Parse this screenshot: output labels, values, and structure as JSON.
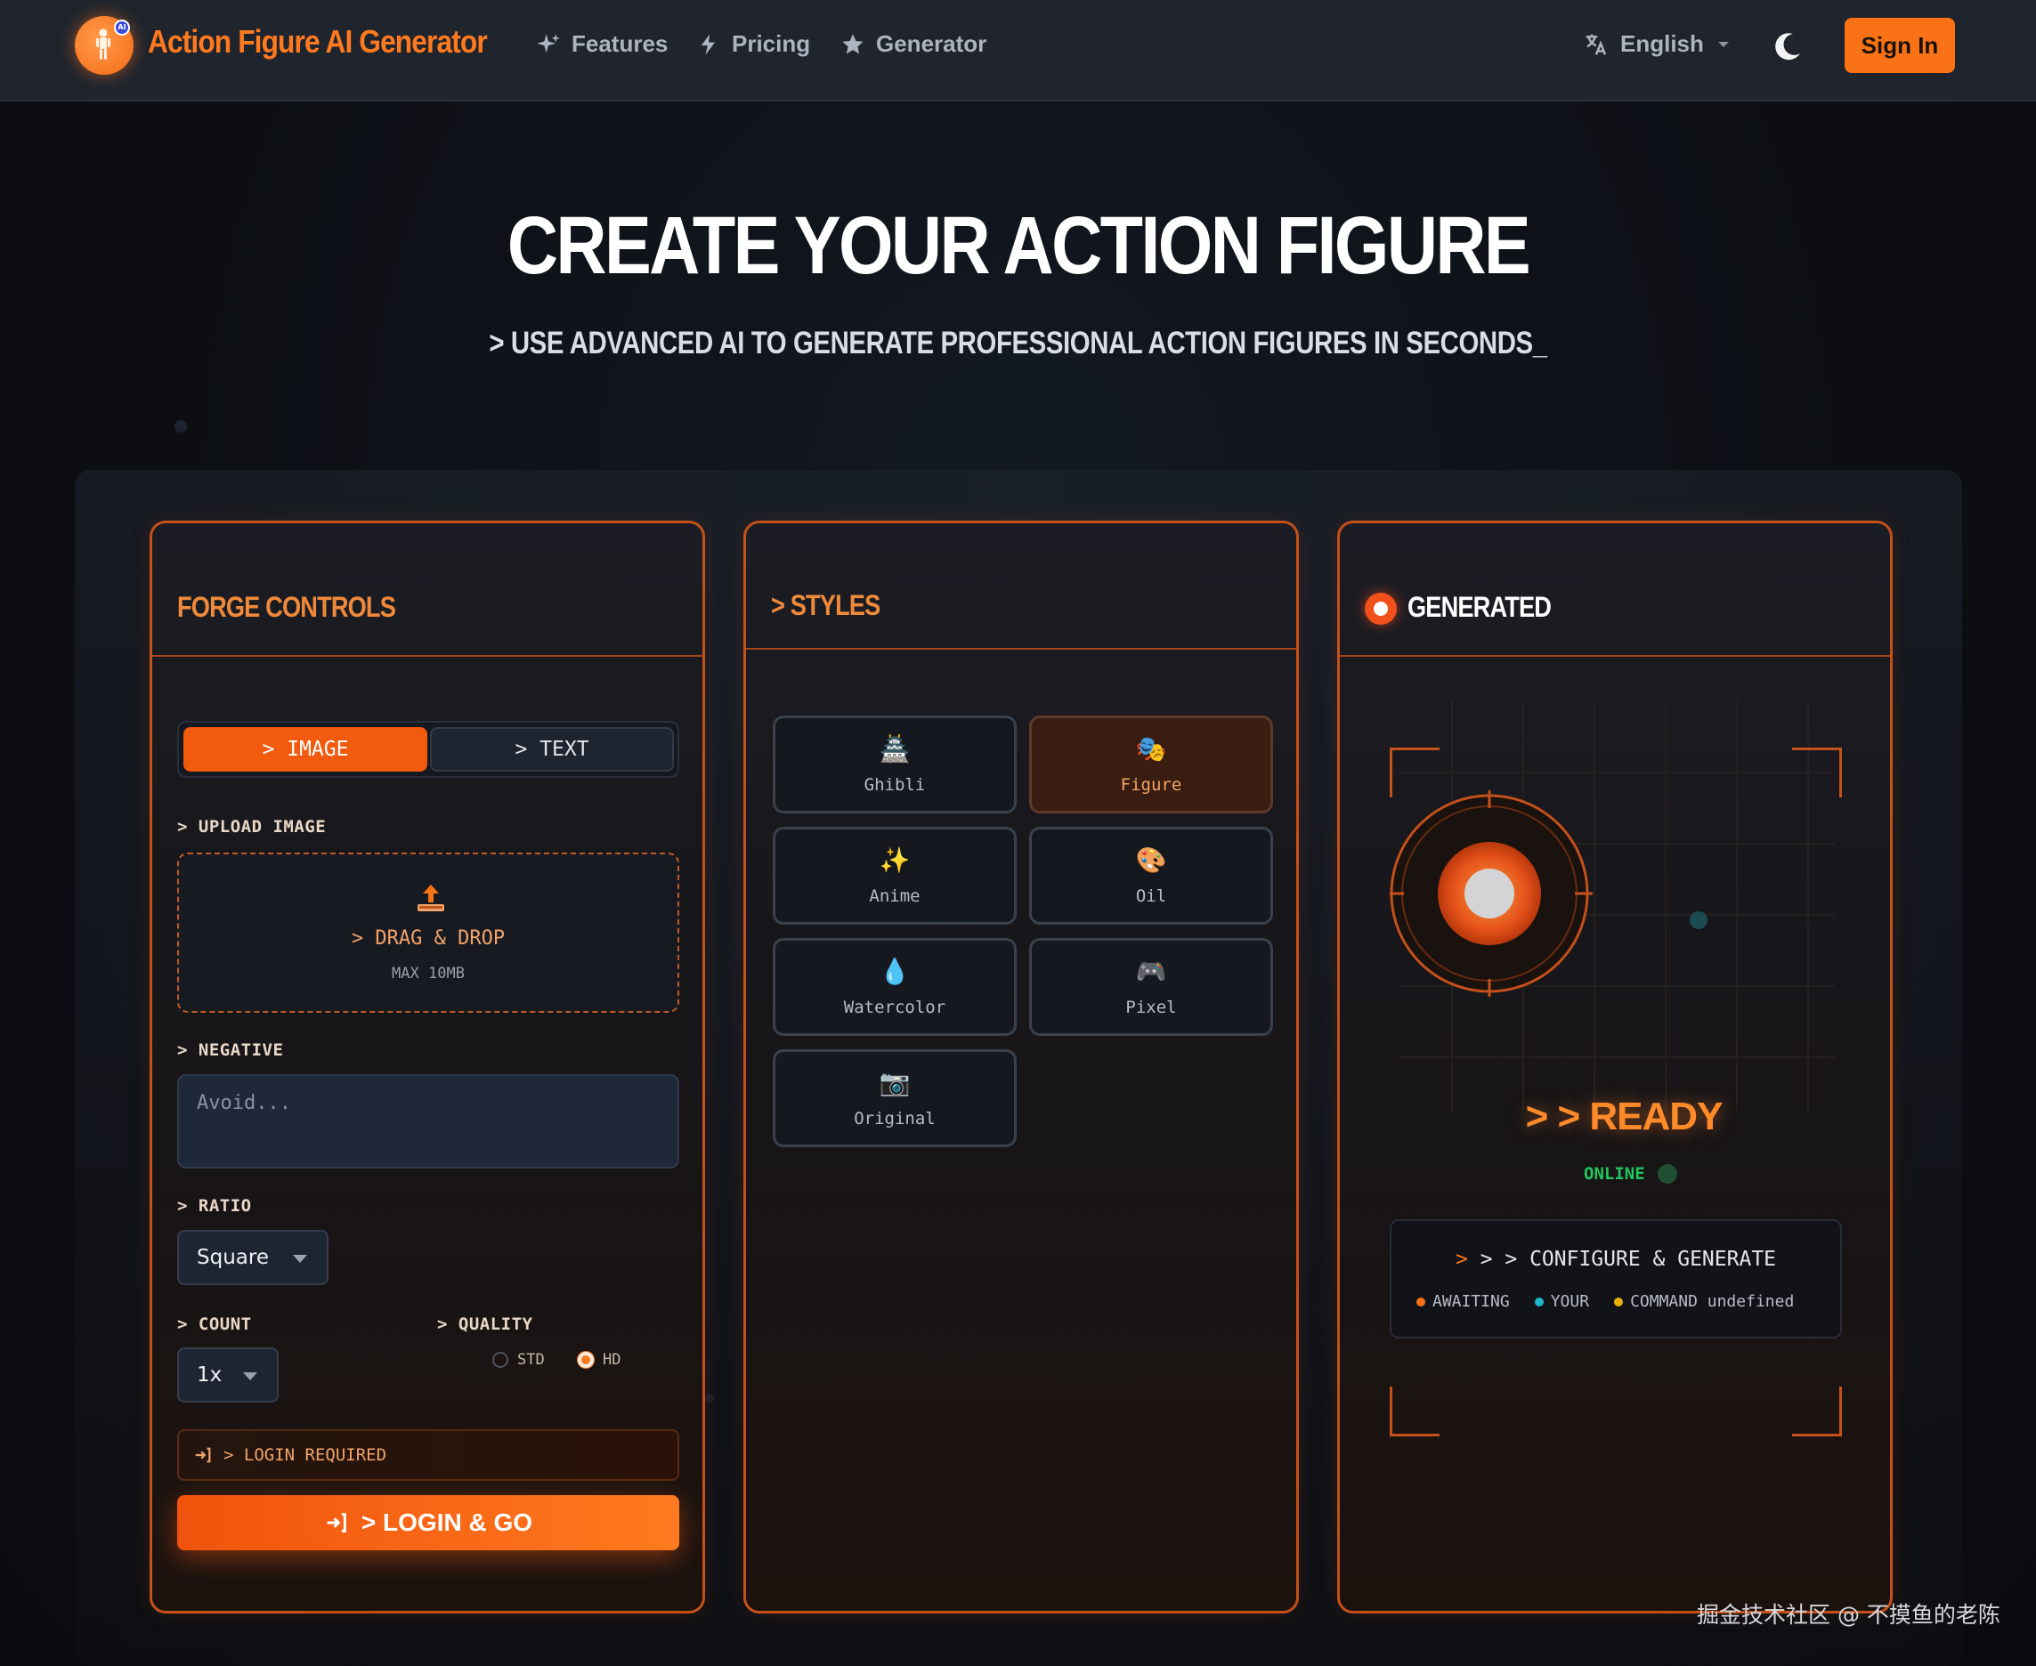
{
  "nav": {
    "brand": "Action Figure AI Generator",
    "logo_badge": "AI",
    "items": [
      {
        "label": "Features",
        "icon": "sparkles-icon"
      },
      {
        "label": "Pricing",
        "icon": "lightning-icon"
      },
      {
        "label": "Generator",
        "icon": "star-icon"
      }
    ],
    "language": "English",
    "sign_in": "Sign In"
  },
  "hero": {
    "title": "CREATE YOUR ACTION FIGURE",
    "subtitle": "> USE ADVANCED AI TO GENERATE PROFESSIONAL ACTION FIGURES IN SECONDS_"
  },
  "forge": {
    "title": "FORGE CONTROLS",
    "tabs": [
      {
        "label": "> IMAGE",
        "active": true
      },
      {
        "label": "> TEXT",
        "active": false
      }
    ],
    "upload_label": "> UPLOAD IMAGE",
    "upload_title": "> DRAG & DROP",
    "upload_sub": "MAX 10MB",
    "negative_label": "> NEGATIVE",
    "negative_placeholder": "Avoid...",
    "ratio_label": "> RATIO",
    "ratio_value": "Square",
    "count_label": "> COUNT",
    "count_value": "1x",
    "quality_label": "> QUALITY",
    "quality_options": [
      {
        "label": "STD",
        "selected": false
      },
      {
        "label": "HD",
        "selected": true
      }
    ],
    "login_required": "> LOGIN REQUIRED",
    "go_button": "> LOGIN & GO"
  },
  "styles": {
    "title": "> STYLES",
    "items": [
      {
        "label": "Ghibli",
        "icon": "🏯",
        "selected": false
      },
      {
        "label": "Figure",
        "icon": "🎭",
        "selected": true
      },
      {
        "label": "Anime",
        "icon": "✨",
        "selected": false
      },
      {
        "label": "Oil",
        "icon": "🎨",
        "selected": false
      },
      {
        "label": "Watercolor",
        "icon": "💧",
        "selected": false
      },
      {
        "label": "Pixel",
        "icon": "🎮",
        "selected": false
      },
      {
        "label": "Original",
        "icon": "📷",
        "selected": false
      }
    ]
  },
  "generated": {
    "title": "GENERATED",
    "ready": "> > READY",
    "online": "ONLINE",
    "status_title": "> > CONFIGURE & GENERATE",
    "status_words": [
      {
        "label": "AWAITING",
        "color": "#f97316"
      },
      {
        "label": "YOUR",
        "color": "#22b8cf"
      },
      {
        "label": "COMMAND undefined",
        "color": "#eab308"
      }
    ]
  },
  "colors": {
    "accent": "#f97316",
    "panel_border": "#c4501a",
    "online": "#22c55e"
  },
  "watermark": "掘金技术社区 @ 不摸鱼的老陈"
}
